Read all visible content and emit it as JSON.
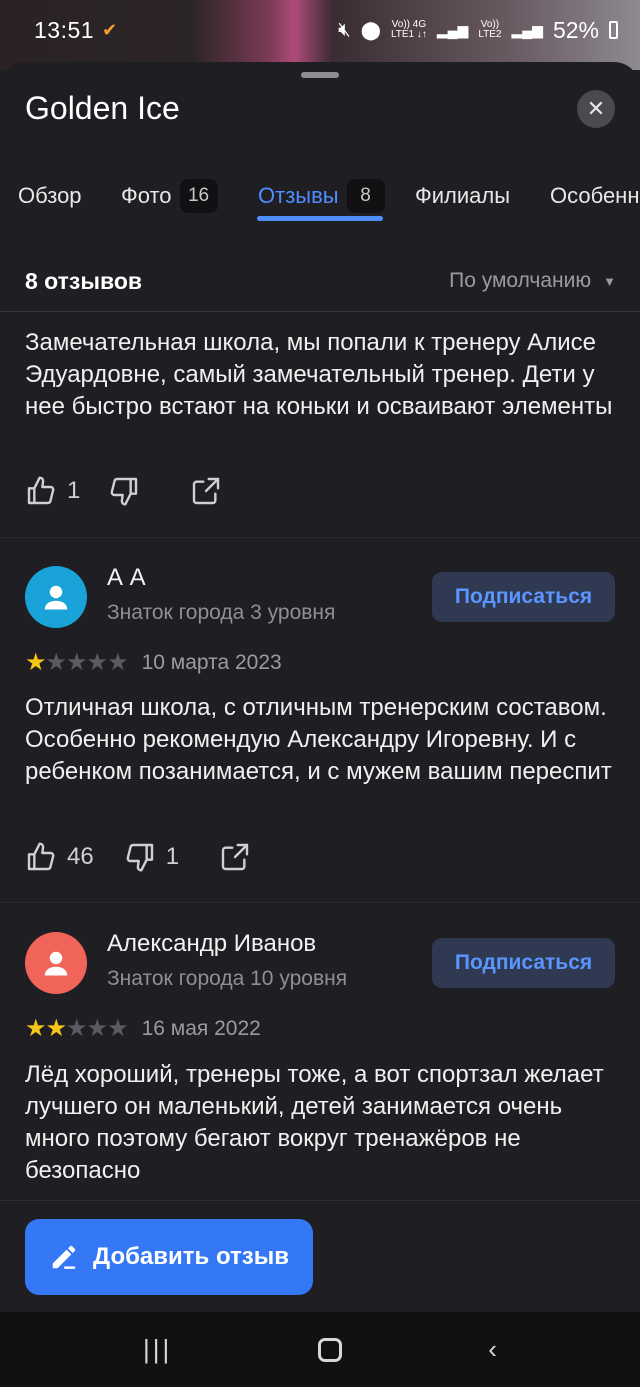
{
  "status_bar": {
    "time": "13:51",
    "battery": "52%",
    "net1_top": "Vo)) 4G",
    "net1_bottom": "LTE1 ↓↑",
    "net2_top": "Vo))",
    "net2_bottom": "LTE2"
  },
  "sheet": {
    "title": "Golden Ice",
    "close_icon": "close-icon"
  },
  "tabs": [
    {
      "label": "Обзор"
    },
    {
      "label": "Фото",
      "count": "16"
    },
    {
      "label": "Отзывы",
      "count": "8",
      "active": true
    },
    {
      "label": "Филиалы"
    },
    {
      "label": "Особенн"
    }
  ],
  "reviews": {
    "count_label": "8 отзывов",
    "sort_label": "По умолчанию",
    "items": [
      {
        "text": "Замечательная школа, мы попали к тренеру Алисе Эдуардовне, самый замечательный тренер. Дети у нее быстро встают на коньки и осваивают элементы",
        "likes": "1",
        "dislikes": ""
      },
      {
        "author": "А А",
        "level": "Знаток города 3 уровня",
        "subscribe": "Подписаться",
        "rating": 1,
        "date": "10 марта 2023",
        "avatar_color": "#1aa3d9",
        "text": "Отличная школа, с отличным тренерским составом. Особенно рекомендую Александру Игоревну. И с ребенком позанимается, и с мужем вашим переспит",
        "likes": "46",
        "dislikes": "1"
      },
      {
        "author": "Александр Иванов",
        "level": "Знаток города 10 уровня",
        "subscribe": "Подписаться",
        "rating": 2,
        "date": "16 мая 2022",
        "avatar_color": "#f0645a",
        "text": "Лёд хороший, тренеры тоже, а вот спортзал желает лучшего он маленький, детей занимается очень много поэтому бегают вокруг тренажёров не безопасно"
      }
    ]
  },
  "add_review_label": "Добавить отзыв",
  "nav": {
    "recent_icon": "recent-apps-icon",
    "home_icon": "home-icon",
    "back_icon": "back-icon"
  },
  "colors": {
    "accent": "#3478f6",
    "tab_active": "#4f8cff",
    "star": "#f5c518",
    "background": "#1f1f23"
  }
}
